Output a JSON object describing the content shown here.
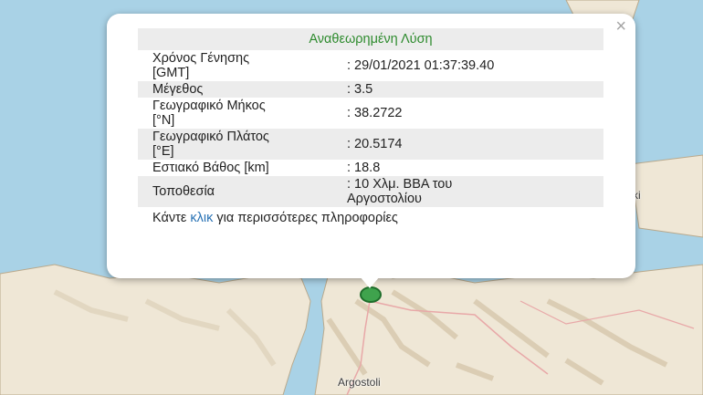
{
  "map": {
    "city_label": "Argostoli",
    "edge_label": "ki",
    "colors": {
      "sea": "#a9d2e6",
      "land": "#efe7d6",
      "relief": "#d9cbb0",
      "marker": "#3fa34d"
    }
  },
  "popup": {
    "title": "Αναθεωρημένη Λύση",
    "close_icon": "×",
    "rows": [
      {
        "key_line1": "Χρόνος Γένησης",
        "key_line2": "[GMT]",
        "value_line1": ": 29/01/2021 01:37:39.40",
        "value_line2": ""
      },
      {
        "key_line1": "Μέγεθος",
        "key_line2": "",
        "value_line1": ": 3.5",
        "value_line2": ""
      },
      {
        "key_line1": "Γεωγραφικό Μήκος",
        "key_line2": "[°N]",
        "value_line1": ": 38.2722",
        "value_line2": ""
      },
      {
        "key_line1": "Γεωγραφικό Πλάτος",
        "key_line2": "[°E]",
        "value_line1": ": 20.5174",
        "value_line2": ""
      },
      {
        "key_line1": "Εστιακό Βάθος [km]",
        "key_line2": "",
        "value_line1": ": 18.8",
        "value_line2": ""
      },
      {
        "key_line1": "Τοποθεσία",
        "key_line2": "",
        "value_line1": ": 10 Χλμ. ΒΒΑ του",
        "value_line2": "Αργοστολίου"
      }
    ],
    "more_prefix": "Κάντε ",
    "more_link": "κλικ",
    "more_suffix": " για περισσότερες πληροφορίες"
  }
}
